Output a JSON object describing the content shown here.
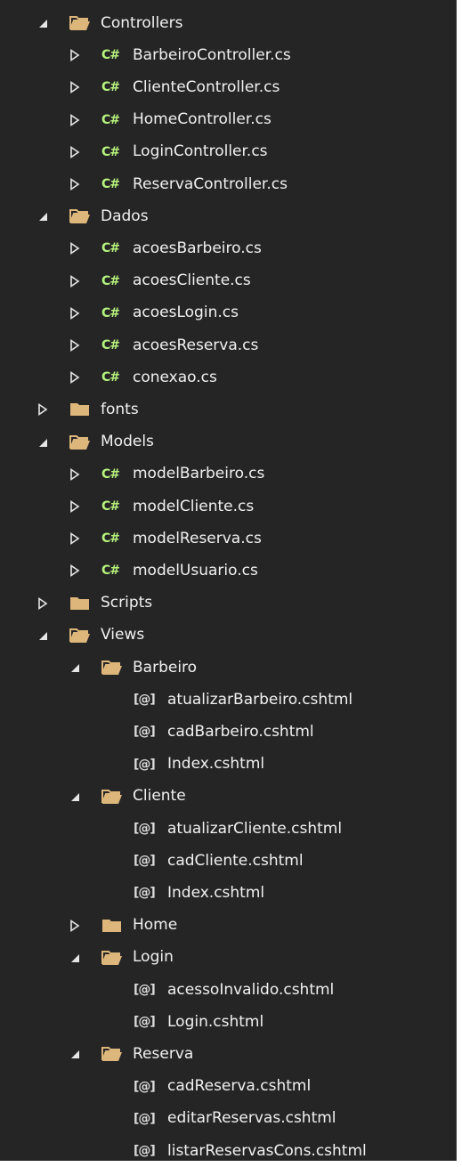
{
  "icons": {
    "folder_open": "folder-open-icon",
    "folder_closed": "folder-closed-icon",
    "csharp": "csharp-file-icon",
    "razor": "razor-file-icon",
    "expanded": "expanded-triangle-icon",
    "collapsed": "collapsed-triangle-icon"
  },
  "colors": {
    "background": "#252526",
    "text": "#f1f1f1",
    "folder": "#dcb67a",
    "csharp": "#b6f27c"
  },
  "glyphs": {
    "csharp": "C#",
    "razor": "[@]"
  },
  "tree": [
    {
      "label": "Controllers",
      "kind": "folder",
      "state": "open",
      "level": 0
    },
    {
      "label": "BarbeiroController.cs",
      "kind": "cs",
      "state": "collapsed",
      "level": 1
    },
    {
      "label": "ClienteController.cs",
      "kind": "cs",
      "state": "collapsed",
      "level": 1
    },
    {
      "label": "HomeController.cs",
      "kind": "cs",
      "state": "collapsed",
      "level": 1
    },
    {
      "label": "LoginController.cs",
      "kind": "cs",
      "state": "collapsed",
      "level": 1
    },
    {
      "label": "ReservaController.cs",
      "kind": "cs",
      "state": "collapsed",
      "level": 1
    },
    {
      "label": "Dados",
      "kind": "folder",
      "state": "open",
      "level": 0
    },
    {
      "label": "acoesBarbeiro.cs",
      "kind": "cs",
      "state": "collapsed",
      "level": 1
    },
    {
      "label": "acoesCliente.cs",
      "kind": "cs",
      "state": "collapsed",
      "level": 1
    },
    {
      "label": "acoesLogin.cs",
      "kind": "cs",
      "state": "collapsed",
      "level": 1
    },
    {
      "label": "acoesReserva.cs",
      "kind": "cs",
      "state": "collapsed",
      "level": 1
    },
    {
      "label": "conexao.cs",
      "kind": "cs",
      "state": "collapsed",
      "level": 1
    },
    {
      "label": "fonts",
      "kind": "folder",
      "state": "closed",
      "level": 0
    },
    {
      "label": "Models",
      "kind": "folder",
      "state": "open",
      "level": 0
    },
    {
      "label": "modelBarbeiro.cs",
      "kind": "cs",
      "state": "collapsed",
      "level": 1
    },
    {
      "label": "modelCliente.cs",
      "kind": "cs",
      "state": "collapsed",
      "level": 1
    },
    {
      "label": "modelReserva.cs",
      "kind": "cs",
      "state": "collapsed",
      "level": 1
    },
    {
      "label": "modelUsuario.cs",
      "kind": "cs",
      "state": "collapsed",
      "level": 1
    },
    {
      "label": "Scripts",
      "kind": "folder",
      "state": "closed",
      "level": 0
    },
    {
      "label": "Views",
      "kind": "folder",
      "state": "open",
      "level": 0
    },
    {
      "label": "Barbeiro",
      "kind": "folder",
      "state": "open",
      "level": 1
    },
    {
      "label": "atualizarBarbeiro.cshtml",
      "kind": "razor",
      "state": "none",
      "level": 2
    },
    {
      "label": "cadBarbeiro.cshtml",
      "kind": "razor",
      "state": "none",
      "level": 2
    },
    {
      "label": "Index.cshtml",
      "kind": "razor",
      "state": "none",
      "level": 2
    },
    {
      "label": "Cliente",
      "kind": "folder",
      "state": "open",
      "level": 1
    },
    {
      "label": "atualizarCliente.cshtml",
      "kind": "razor",
      "state": "none",
      "level": 2
    },
    {
      "label": "cadCliente.cshtml",
      "kind": "razor",
      "state": "none",
      "level": 2
    },
    {
      "label": "Index.cshtml",
      "kind": "razor",
      "state": "none",
      "level": 2
    },
    {
      "label": "Home",
      "kind": "folder",
      "state": "closed",
      "level": 1
    },
    {
      "label": "Login",
      "kind": "folder",
      "state": "open",
      "level": 1
    },
    {
      "label": "acessoInvalido.cshtml",
      "kind": "razor",
      "state": "none",
      "level": 2
    },
    {
      "label": "Login.cshtml",
      "kind": "razor",
      "state": "none",
      "level": 2
    },
    {
      "label": "Reserva",
      "kind": "folder",
      "state": "open",
      "level": 1
    },
    {
      "label": "cadReserva.cshtml",
      "kind": "razor",
      "state": "none",
      "level": 2
    },
    {
      "label": "editarReservas.cshtml",
      "kind": "razor",
      "state": "none",
      "level": 2
    },
    {
      "label": "listarReservasCons.cshtml",
      "kind": "razor",
      "state": "none",
      "level": 2
    }
  ]
}
